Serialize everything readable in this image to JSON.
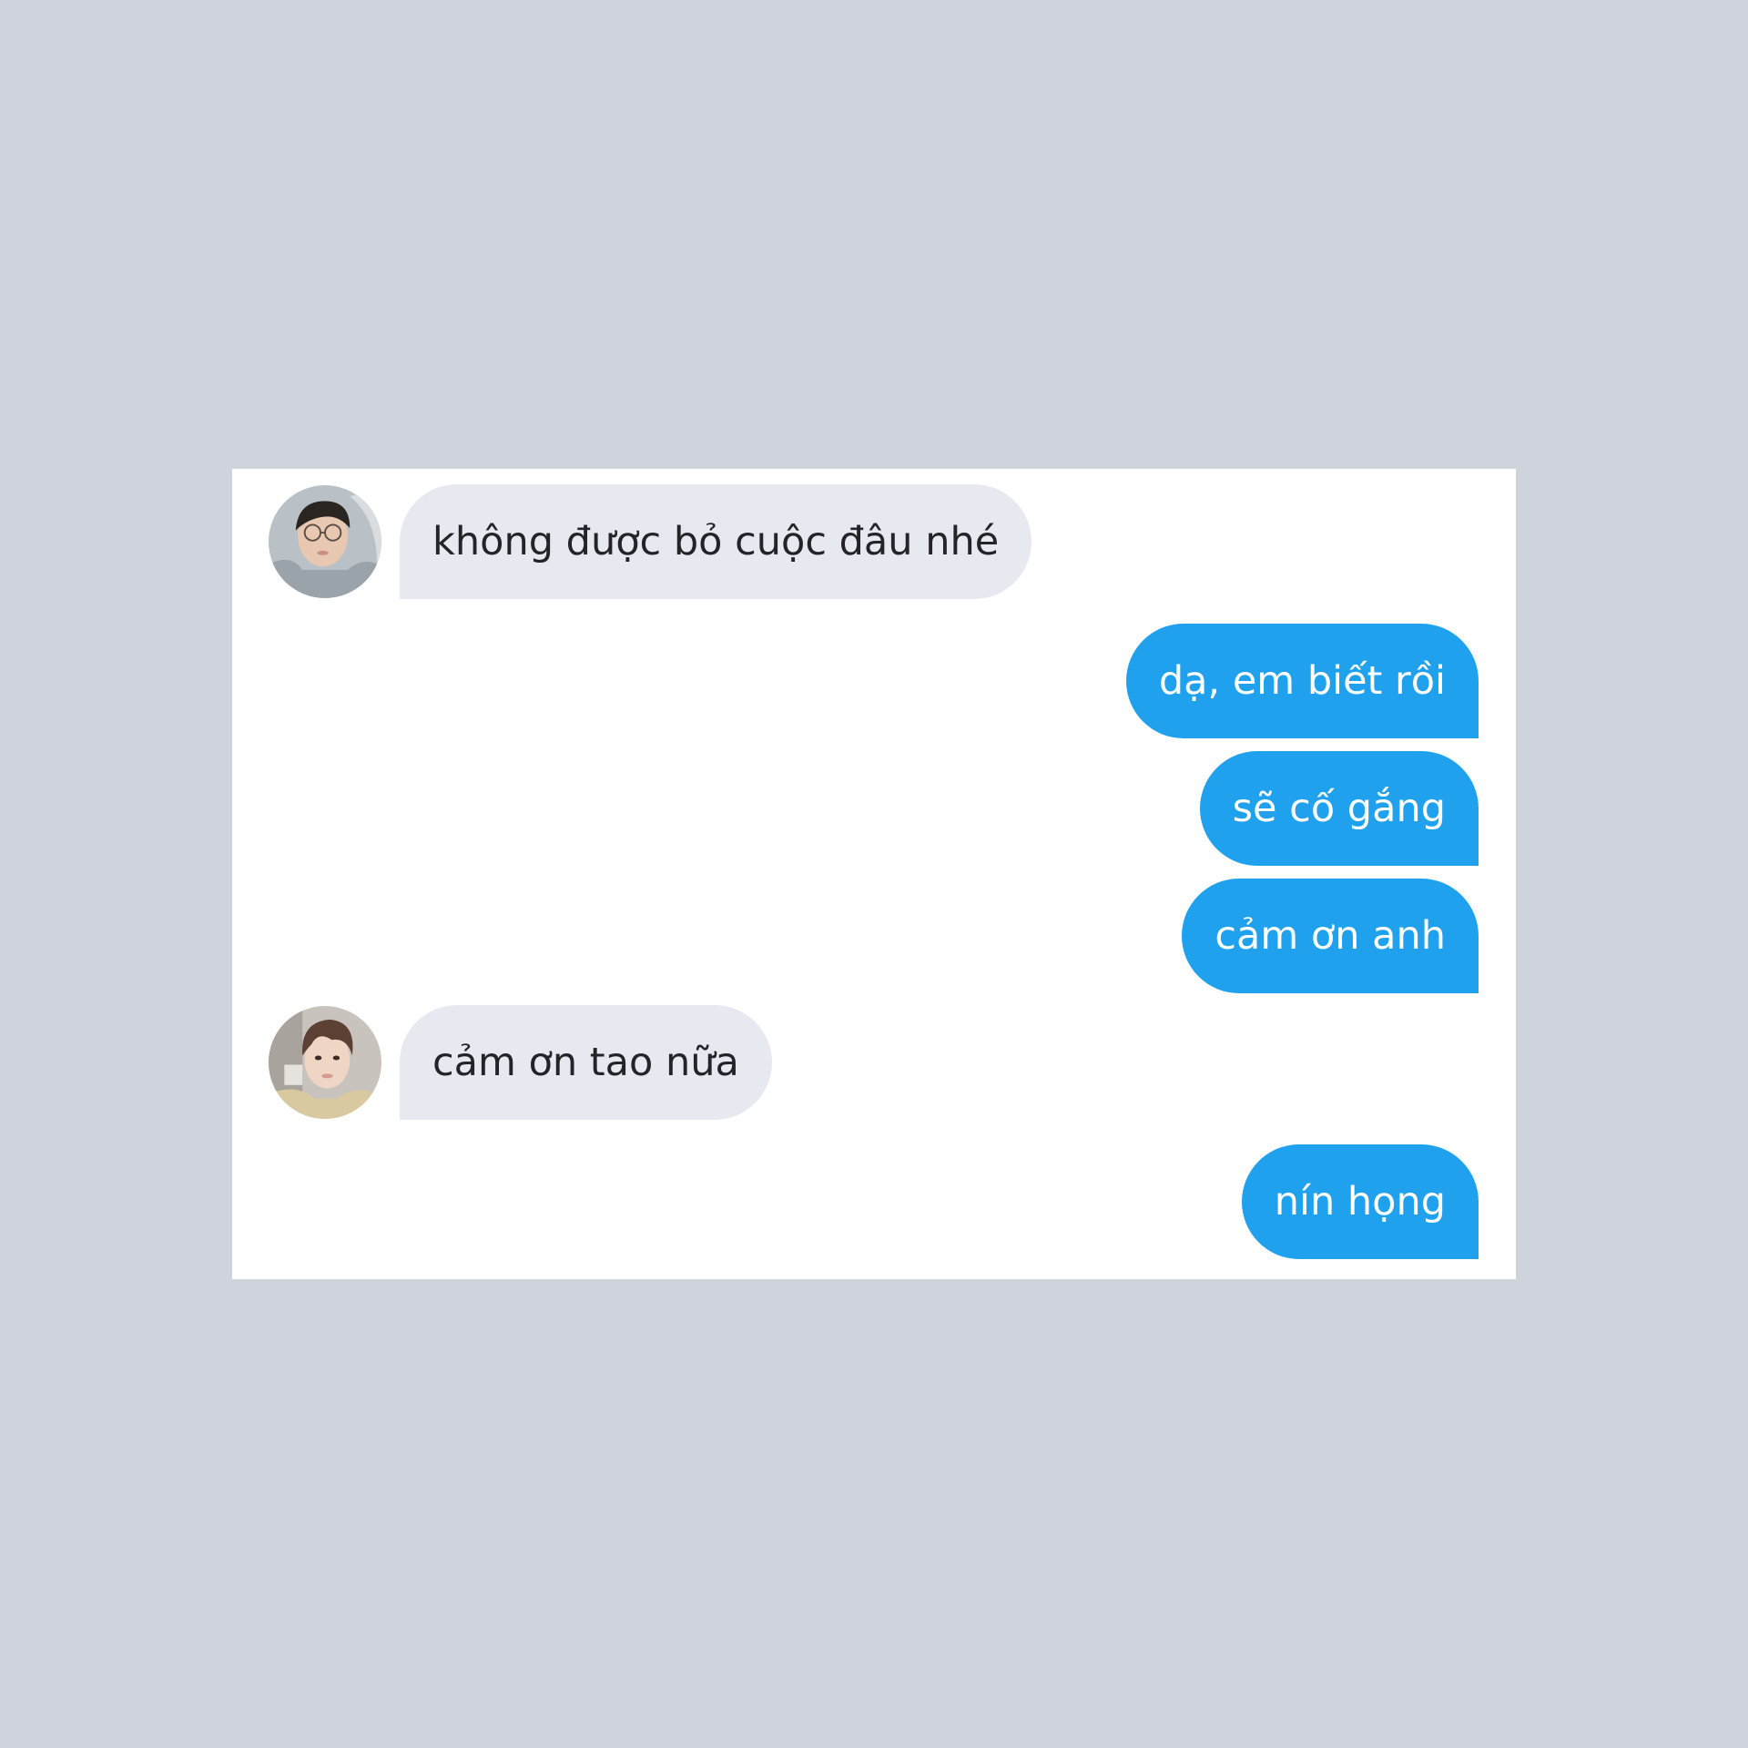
{
  "colors": {
    "page_background": "#cfd3dc",
    "card_background": "#ffffff",
    "incoming_bubble": "#e6e9ef",
    "outgoing_bubble": "#1fa1ee",
    "incoming_text": "#222428",
    "outgoing_text": "#ffffff"
  },
  "messages": [
    {
      "side": "incoming",
      "text": "không được bỏ cuộc đâu nhé",
      "avatar": "avatar-photo-glasses"
    },
    {
      "side": "outgoing",
      "text": "dạ, em biết rồi"
    },
    {
      "side": "outgoing",
      "text": "sẽ cố gắng"
    },
    {
      "side": "outgoing",
      "text": "cảm ơn anh"
    },
    {
      "side": "incoming",
      "text": "cảm ơn tao nữa",
      "avatar": "avatar-photo"
    },
    {
      "side": "outgoing",
      "text": "nín họng"
    }
  ]
}
